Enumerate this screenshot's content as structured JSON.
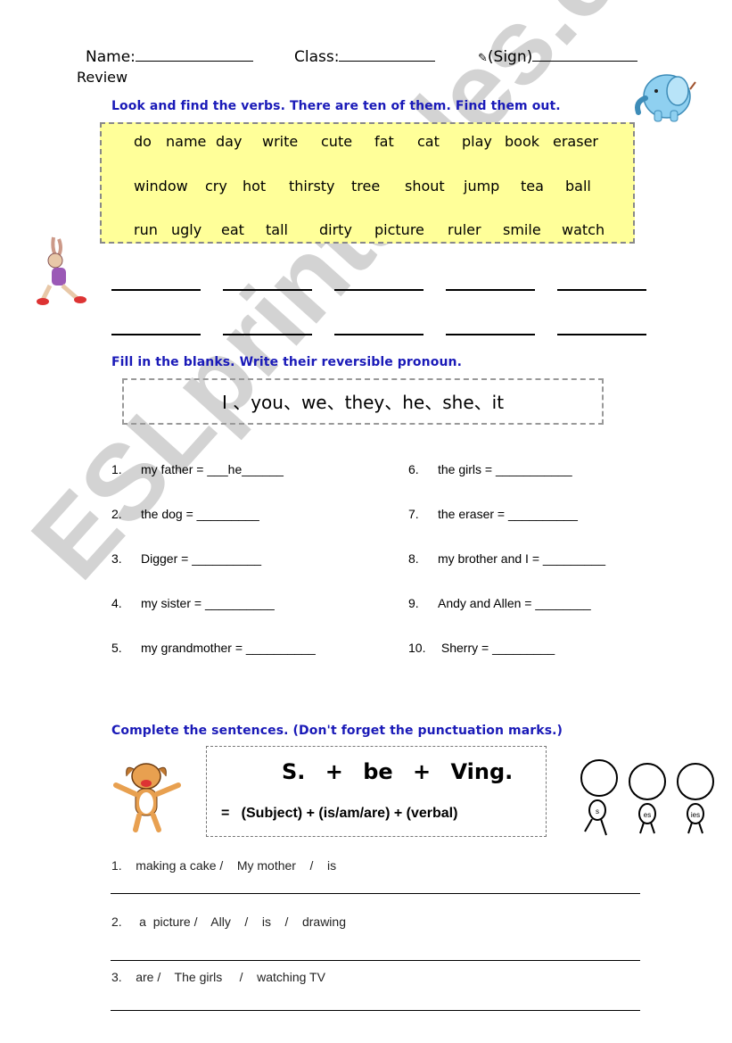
{
  "header": {
    "name_label": "Name:",
    "class_label": "Class:",
    "sign_icon": "pencil-icon",
    "sign_label": "(Sign)",
    "subtitle": "Review"
  },
  "section1": {
    "instruction": "Look and find the verbs. There are ten of them. Find them out.",
    "word_rows": [
      [
        "do",
        "name",
        "day",
        "write",
        "cute",
        "fat",
        "cat",
        "play",
        "book",
        "eraser"
      ],
      [
        "window",
        "cry",
        "hot",
        "thirsty",
        "tree",
        "shout",
        "jump",
        "tea",
        "ball"
      ],
      [
        "run",
        "ugly",
        "eat",
        "tall",
        "dirty",
        "picture",
        "ruler",
        "smile",
        "watch"
      ]
    ],
    "answer_blank_count": 10
  },
  "section2": {
    "instruction": "Fill in the blanks. Write their reversible pronoun.",
    "pronouns": "I 、you、we、they、he、she、it",
    "items": [
      {
        "num": "1.",
        "text": "my father = ",
        "answer": "___he______"
      },
      {
        "num": "2.",
        "text": "the dog = ",
        "answer": "_________"
      },
      {
        "num": "3.",
        "text": "Digger = ",
        "answer": "__________"
      },
      {
        "num": "4.",
        "text": "my sister = ",
        "answer": "__________"
      },
      {
        "num": "5.",
        "text": "my grandmother = ",
        "answer": "__________"
      },
      {
        "num": "6.",
        "text": "the girls = ",
        "answer": "___________"
      },
      {
        "num": "7.",
        "text": "the eraser = ",
        "answer": "__________"
      },
      {
        "num": "8.",
        "text": "my brother and I = ",
        "answer": "_________"
      },
      {
        "num": "9.",
        "text": "Andy and Allen = ",
        "answer": "________"
      },
      {
        "num": "10.",
        "text": " Sherry = ",
        "answer": "_________"
      }
    ]
  },
  "section3": {
    "instruction": "Complete the sentences. (Don't forget the punctuation marks.)",
    "formula": "S. + be + Ving.",
    "formula_expanded": "=   (Subject) + (is/am/are) + (verbal)",
    "figure_labels": [
      "s",
      "es",
      "ies"
    ],
    "sentences": [
      {
        "num": "1.",
        "text": "making a cake /    My mother    /    is"
      },
      {
        "num": "2.",
        "text": " a  picture /    Ally    /    is    /    drawing"
      },
      {
        "num": "3.",
        "text": "are /    The girls     /    watching TV"
      }
    ]
  },
  "watermark": "ESLprintables.com"
}
